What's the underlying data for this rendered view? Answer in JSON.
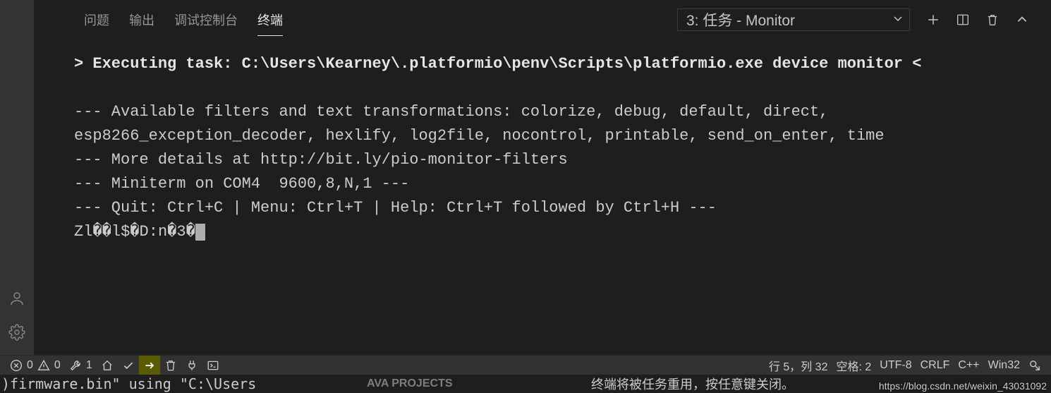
{
  "tabs": {
    "problems": "问题",
    "output": "输出",
    "debug_console": "调试控制台",
    "terminal": "终端"
  },
  "terminal_name": "3: 任务 - Monitor",
  "terminal_lines": {
    "l1": "> Executing task: C:\\Users\\Kearney\\.platformio\\penv\\Scripts\\platformio.exe device monitor <",
    "l2": "--- Available filters and text transformations: colorize, debug, default, direct, esp8266_exception_decoder, hexlify, log2file, nocontrol, printable, send_on_enter, time",
    "l3": "--- More details at http://bit.ly/pio-monitor-filters",
    "l4": "--- Miniterm on COM4  9600,8,N,1 ---",
    "l5": "--- Quit: Ctrl+C | Menu: Ctrl+T | Help: Ctrl+T followed by Ctrl+H ---",
    "l6": "Zl��l$�D:n�3�"
  },
  "status": {
    "errors": "0",
    "warnings": "0",
    "tools": "1",
    "ln_col": "行 5，列 32",
    "spaces": "空格: 2",
    "encoding": "UTF-8",
    "eol": "CRLF",
    "lang": "C++",
    "platform": "Win32"
  },
  "leak": {
    "left": ")firmware.bin\" using \"C:\\Users",
    "projects": "AVA PROJECTS",
    "cn": "终端将被任务重用，按任意键关闭。",
    "watermark": "https://blog.csdn.net/weixin_43031092"
  },
  "icons": {
    "account": "account-icon",
    "settings": "gear-icon",
    "new_terminal": "plus-icon",
    "split": "split-icon",
    "trash": "trash-icon",
    "maximize": "chevron-up-icon",
    "chevron_down": "chevron-down-icon",
    "error": "error-icon",
    "warning": "warning-icon",
    "wrench": "wrench-icon",
    "home": "home-icon",
    "check": "check-icon",
    "arrow_right": "arrow-right-icon",
    "trash2": "trash-icon",
    "plug": "plug-icon",
    "cmd": "terminal-square-icon",
    "feedback": "feedback-icon"
  }
}
